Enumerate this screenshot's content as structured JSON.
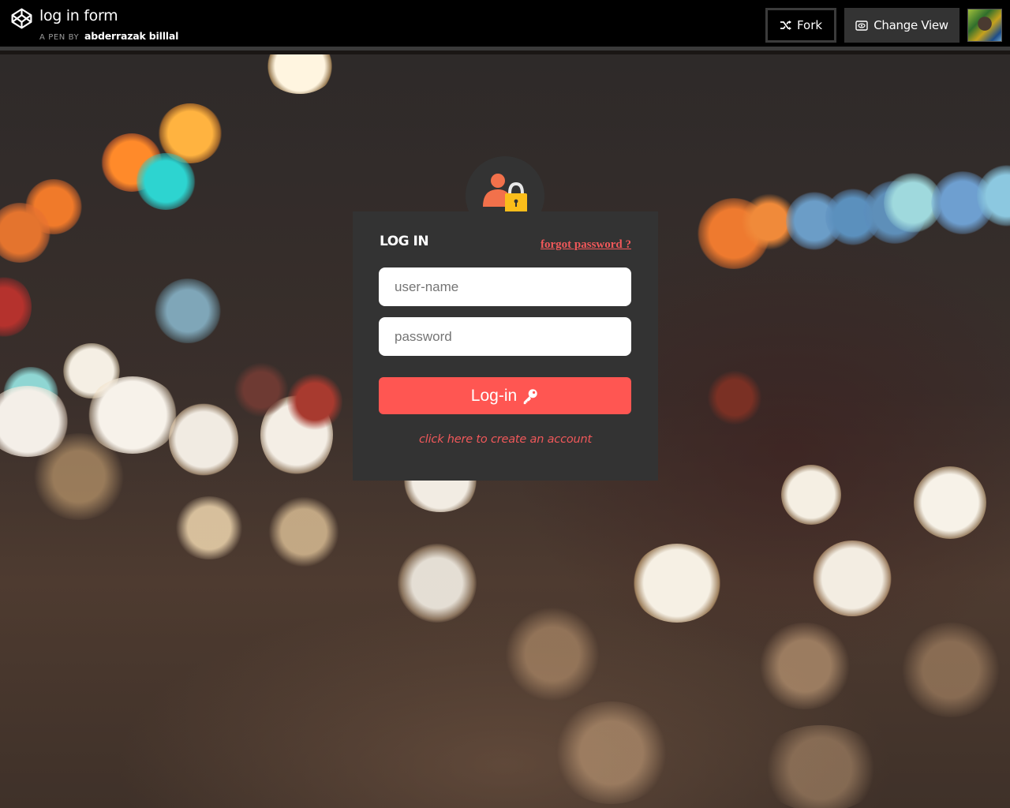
{
  "header": {
    "title": "log in form",
    "by_label": "A PEN BY",
    "author": "abderrazak billlal",
    "fork_label": "Fork",
    "change_view_label": "Change View"
  },
  "login": {
    "title": "LOG IN",
    "forgot_label": "forgot password ?",
    "username_placeholder": "user-name",
    "password_placeholder": "password",
    "submit_label": "Log-in",
    "create_account_label": "click here to create an account"
  },
  "colors": {
    "accent": "#ff5652",
    "link": "#f0585a",
    "card": "#333333",
    "topbar": "#000000"
  },
  "icons": {
    "logo": "codepen-logo-icon",
    "fork": "fork-icon",
    "change_view": "eye-icon",
    "user_lock": "user-lock-icon",
    "key": "key-icon"
  }
}
